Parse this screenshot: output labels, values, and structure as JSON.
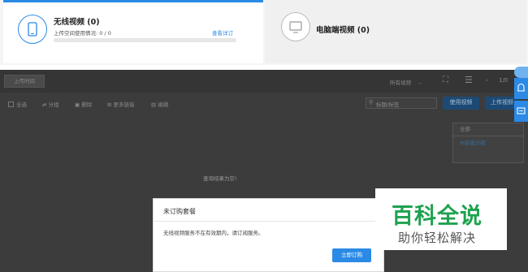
{
  "tabs": {
    "wireless": {
      "title": "无线视频 (0)",
      "usage": "上传空间使用情况: 0 / 0",
      "link": "查看详订",
      "progress": 0
    },
    "pc": {
      "title": "电脑端视频 (0)"
    }
  },
  "toolbar": {
    "upload_tab": "上传时间",
    "filter": "所有视频",
    "page": "1/0",
    "select_all": "全选",
    "share": "分组",
    "delete": "删除",
    "sort": "更多链接",
    "edit": "编辑",
    "search_placeholder": "标题/标签",
    "use_video": "使用视频",
    "upload_video": "上传视频"
  },
  "group_panel": {
    "header": "全部",
    "item": "⊕新建分组"
  },
  "empty_text": "查询结果为空!",
  "modal": {
    "title": "未订购套餐",
    "message": "无线视频服务不在有效期内，请订阅服务。",
    "button": "立即订购"
  },
  "watermark": {
    "main": "百科全说",
    "sub": "助你轻松解决"
  },
  "colors": {
    "accent": "#2a8ae6",
    "watermark": "#1ea24f",
    "overlay": "#3c3c3c"
  },
  "icons": {
    "wireless": "phone-icon",
    "pc": "monitor-icon"
  }
}
